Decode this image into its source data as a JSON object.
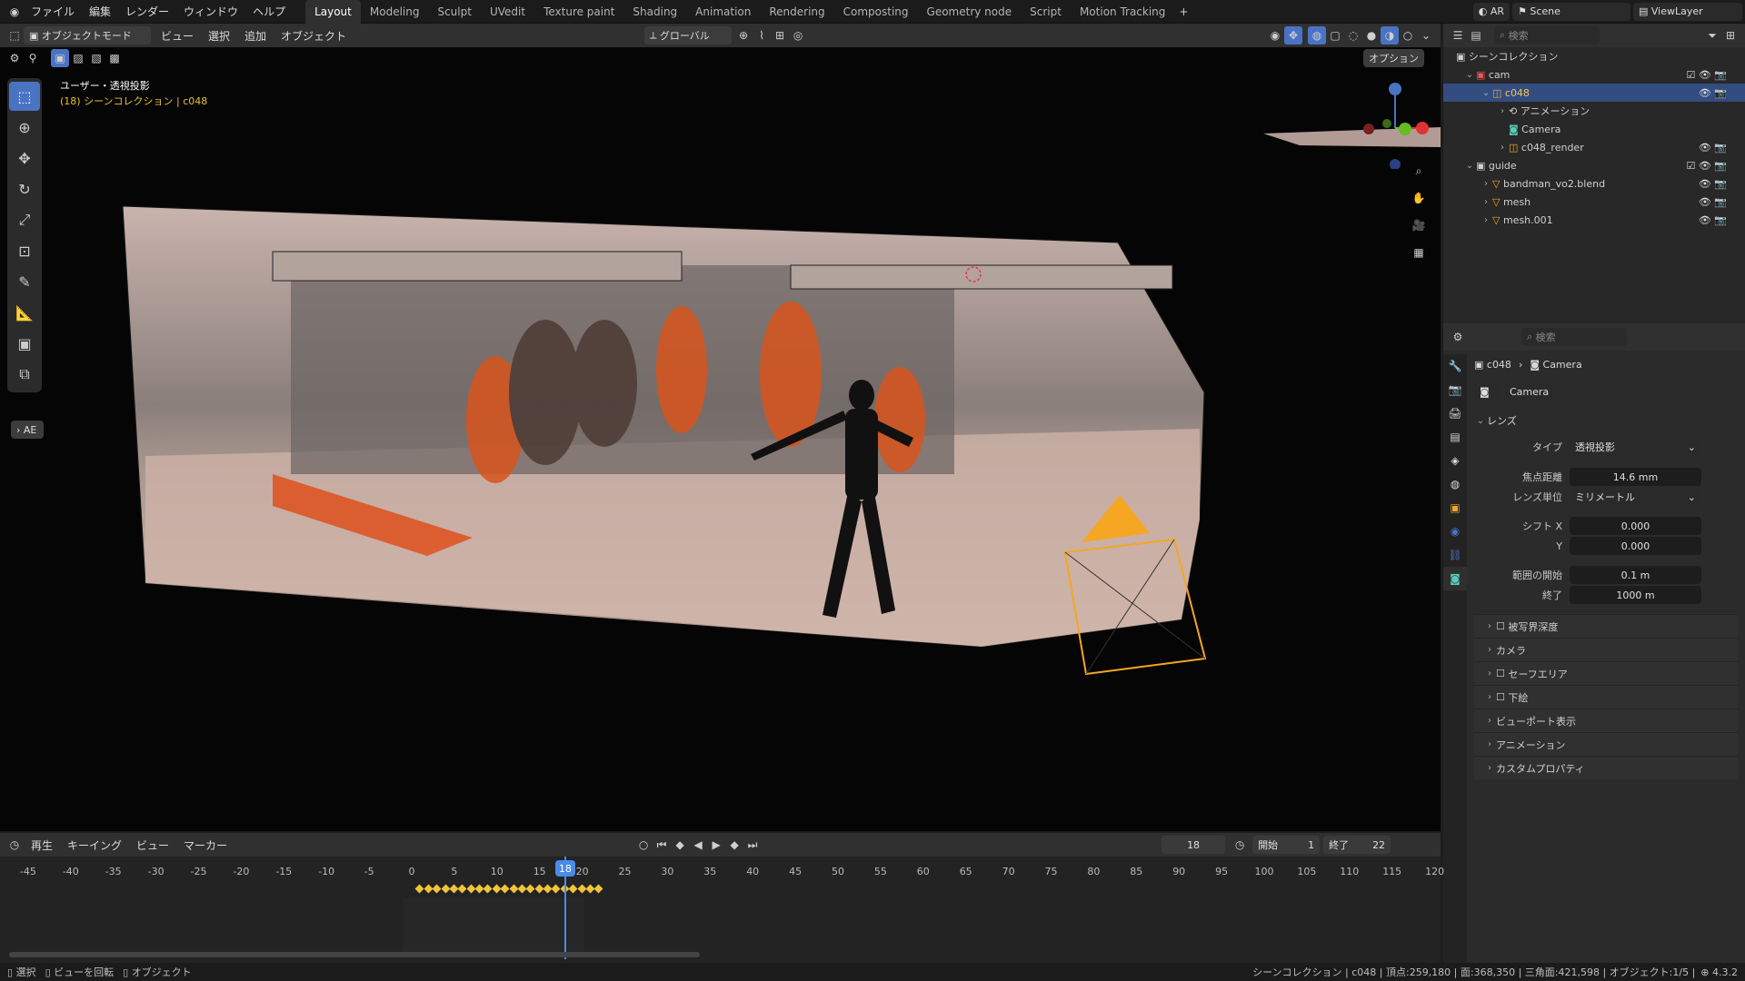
{
  "topbar": {
    "menus": [
      "ファイル",
      "編集",
      "レンダー",
      "ウィンドウ",
      "ヘルプ"
    ],
    "workspaces": [
      "Layout",
      "Modeling",
      "Sculpt",
      "UVedit",
      "Texture paint",
      "Shading",
      "Animation",
      "Rendering",
      "Composting",
      "Geometry node",
      "Script",
      "Motion Tracking"
    ],
    "active_workspace": "Layout",
    "lang_badge": "AR",
    "scene": "Scene",
    "viewlayer": "ViewLayer"
  },
  "viewport_header": {
    "mode": "オブジェクトモード",
    "menus": [
      "ビュー",
      "選択",
      "追加",
      "オブジェクト"
    ],
    "orientation": "グローバル",
    "options": "オプション"
  },
  "viewport": {
    "view_name": "ユーザー・透視投影",
    "collection_info": "(18) シーンコレクション | c048",
    "ae_label": "AE"
  },
  "outliner": {
    "search_placeholder": "検索",
    "root": "シーンコレクション",
    "items": [
      {
        "label": "cam",
        "indent": 1
      },
      {
        "label": "c048",
        "indent": 2
      },
      {
        "label": "アニメーション",
        "indent": 3
      },
      {
        "label": "Camera",
        "indent": 3
      },
      {
        "label": "c048_render",
        "indent": 3
      },
      {
        "label": "guide",
        "indent": 1
      },
      {
        "label": "bandman_vo2.blend",
        "indent": 2
      },
      {
        "label": "mesh",
        "indent": 2
      },
      {
        "label": "mesh.001",
        "indent": 2
      }
    ]
  },
  "properties": {
    "search_placeholder": "検索",
    "breadcrumb_object": "c048",
    "breadcrumb_data": "Camera",
    "datablock": "Camera",
    "lens_panel": "レンズ",
    "type_label": "タイプ",
    "type_value": "透視投影",
    "focal_label": "焦点距離",
    "focal_value": "14.6 mm",
    "unit_label": "レンズ単位",
    "unit_value": "ミリメートル",
    "shiftx_label": "シフト X",
    "shiftx_value": "0.000",
    "shifty_label": "Y",
    "shifty_value": "0.000",
    "clipstart_label": "範囲の開始",
    "clipstart_value": "0.1 m",
    "clipend_label": "終了",
    "clipend_value": "1000 m",
    "panels": [
      "被写界深度",
      "カメラ",
      "セーフエリア",
      "下絵",
      "ビューポート表示",
      "アニメーション",
      "カスタムプロパティ"
    ]
  },
  "timeline": {
    "menus": [
      "再生",
      "キーイング",
      "ビュー",
      "マーカー"
    ],
    "current_frame": "18",
    "start_label": "開始",
    "start_value": "1",
    "end_label": "終了",
    "end_value": "22",
    "ticks": [
      "-45",
      "-40",
      "-35",
      "-30",
      "-25",
      "-20",
      "-15",
      "-10",
      "-5",
      "0",
      "5",
      "10",
      "15",
      "18",
      "20",
      "25",
      "30",
      "35",
      "40",
      "45",
      "50",
      "55",
      "60",
      "65",
      "70",
      "75",
      "80",
      "85",
      "90",
      "95",
      "100",
      "105",
      "110",
      "115",
      "120"
    ]
  },
  "statusbar": {
    "left": [
      "選択",
      "ビューを回転",
      "オブジェクト"
    ],
    "right": "シーンコレクション | c048 | 頂点:259,180 | 面:368,350 | 三角面:421,598 | オブジェクト:1/5 |",
    "version": "4.3.2"
  },
  "colors": {
    "accent": "#4a73c4",
    "selection": "#334d80",
    "keyframe": "#f0c43a",
    "camera": "#f5a623",
    "collection_info": "#e9c233"
  }
}
